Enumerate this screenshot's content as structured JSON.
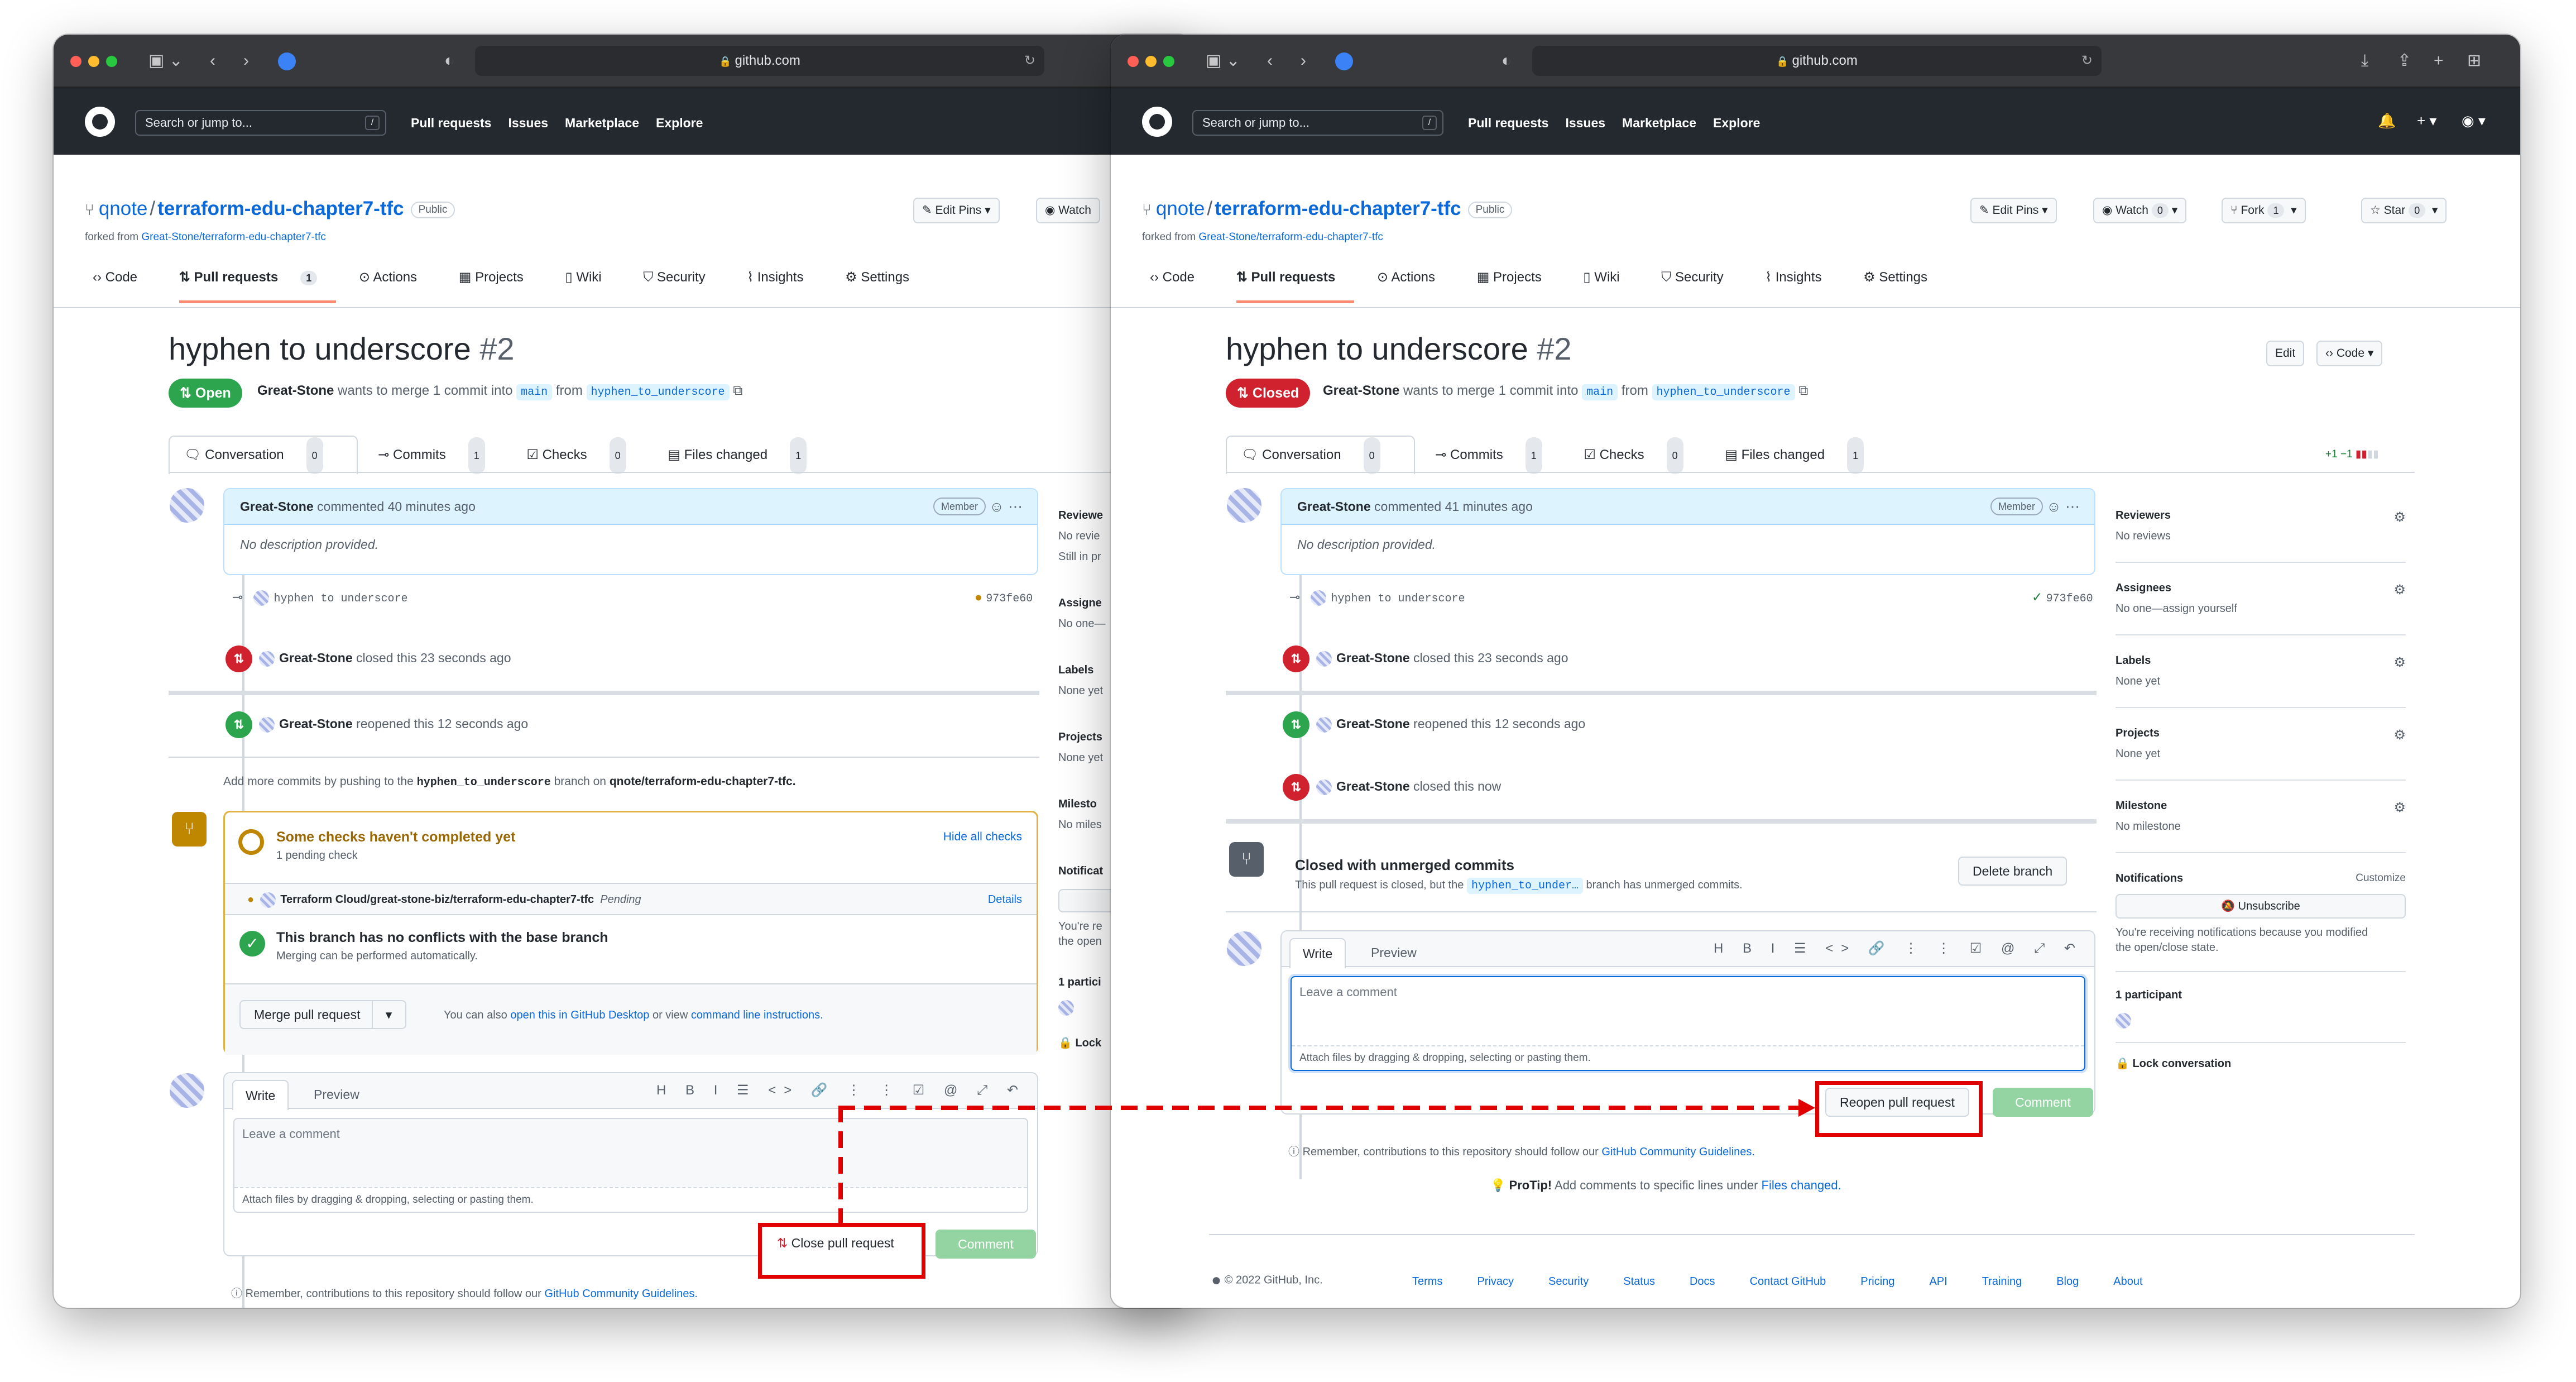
{
  "browser": {
    "url": "github.com"
  },
  "header": {
    "search_placeholder": "Search or jump to...",
    "slash": "/",
    "nav": [
      "Pull requests",
      "Issues",
      "Marketplace",
      "Explore"
    ]
  },
  "repo": {
    "owner": "qnote",
    "name": "terraform-edu-chapter7-tfc",
    "visibility": "Public",
    "forked_from_prefix": "forked from",
    "forked_from": "Great-Stone/terraform-edu-chapter7-tfc"
  },
  "repo_buttons": {
    "edit_pins": "Edit Pins",
    "watch": "Watch",
    "watch_count": "0",
    "fork": "Fork",
    "fork_count": "1",
    "star": "Star",
    "star_count": "0"
  },
  "repo_tabs": {
    "code": "Code",
    "pull_requests": "Pull requests",
    "pr_count": "1",
    "actions": "Actions",
    "projects": "Projects",
    "wiki": "Wiki",
    "security": "Security",
    "insights": "Insights",
    "settings": "Settings"
  },
  "pr": {
    "title": "hyphen to underscore",
    "number": "#2",
    "state_open": "Open",
    "state_closed": "Closed",
    "author": "Great-Stone",
    "merge_text": "wants to merge 1 commit into",
    "base": "main",
    "from": "from",
    "head": "hyphen_to_underscore",
    "edit": "Edit",
    "code_btn": "Code"
  },
  "pr_tabs": {
    "conversation": "Conversation",
    "conversation_count": "0",
    "commits": "Commits",
    "commits_count": "1",
    "checks": "Checks",
    "checks_count_left": "0",
    "checks_count_right": "0",
    "files": "Files changed",
    "files_count": "1",
    "diffstat": "+1 −1"
  },
  "comment": {
    "author": "Great-Stone",
    "time_left": "commented 40 minutes ago",
    "time_right": "commented 41 minutes ago",
    "member": "Member",
    "body": "No description provided."
  },
  "commit": {
    "message": "hyphen to underscore",
    "sha": "973fe60"
  },
  "events": {
    "actor": "Great-Stone",
    "closed1": "closed this 23 seconds ago",
    "reopened": "reopened this 12 seconds ago",
    "closed_now": "closed this now"
  },
  "merge_box": {
    "push_hint_prefix": "Add more commits by pushing to the",
    "push_branch": "hyphen_to_underscore",
    "push_hint_mid": "branch on",
    "push_repo": "qnote/terraform-edu-chapter7-tfc.",
    "checks_title": "Some checks haven't completed yet",
    "checks_sub": "1 pending check",
    "hide": "Hide all checks",
    "check_name": "Terraform Cloud/great-stone-biz/terraform-edu-chapter7-tfc",
    "pending": "Pending",
    "details": "Details",
    "conflict_title": "This branch has no conflicts with the base branch",
    "conflict_sub": "Merging can be performed automatically.",
    "merge_btn": "Merge pull request",
    "also_prefix": "You can also",
    "desktop_link": "open this in GitHub Desktop",
    "also_mid": "or view",
    "cli_link": "command line instructions."
  },
  "closed_box": {
    "title": "Closed with unmerged commits",
    "sub_prefix": "This pull request is closed, but the",
    "branch": "hyphen_to_under…",
    "sub_suffix": "branch has unmerged commits.",
    "delete": "Delete branch"
  },
  "editor": {
    "write": "Write",
    "preview": "Preview",
    "tools": "H B I ☰ <> 🔗 ⋮ ⋮ ☑ @ ⤢ ↶",
    "placeholder": "Leave a comment",
    "attach": "Attach files by dragging & dropping, selecting or pasting them.",
    "close_btn": "Close pull request",
    "reopen_btn": "Reopen pull request",
    "comment_btn": "Comment"
  },
  "guidelines": {
    "prefix": "Remember, contributions to this repository should follow our",
    "link": "GitHub Community Guidelines."
  },
  "protip": {
    "label": "ProTip!",
    "text": "Add comments to specific lines under",
    "link": "Files changed."
  },
  "sidebar": {
    "reviewers": "Reviewers",
    "reviewers_val": "No reviews",
    "assignees": "Assignees",
    "assignees_val": "No one—assign yourself",
    "labels": "Labels",
    "labels_val": "None yet",
    "projects": "Projects",
    "projects_val": "None yet",
    "milestone": "Milestone",
    "milestone_val": "No milestone",
    "notifications": "Notifications",
    "customize": "Customize",
    "unsubscribe": "Unsubscribe",
    "notif_text1": "You're receiving notifications because you modified",
    "notif_text2": "the open/close state.",
    "participants": "1 participant",
    "lock": "Lock conversation"
  },
  "sidebar_left": {
    "reviewers": "Reviewe",
    "reviewers_val": "No revie",
    "reviewers_val2": "Still in pr",
    "assignees": "Assigne",
    "assignees_val": "No one—",
    "labels": "Labels",
    "labels_val": "None yet",
    "projects": "Projects",
    "projects_val": "None yet",
    "milestone": "Milesto",
    "milestone_val": "No miles",
    "notifications": "Notificat",
    "notif_text1": "You're re",
    "notif_text2": "the open",
    "participants": "1 partici",
    "lock": "Lock"
  },
  "footer": {
    "copyright": "© 2022 GitHub, Inc.",
    "links": [
      "Terms",
      "Privacy",
      "Security",
      "Status",
      "Docs",
      "Contact GitHub",
      "Pricing",
      "API",
      "Training",
      "Blog",
      "About"
    ]
  }
}
